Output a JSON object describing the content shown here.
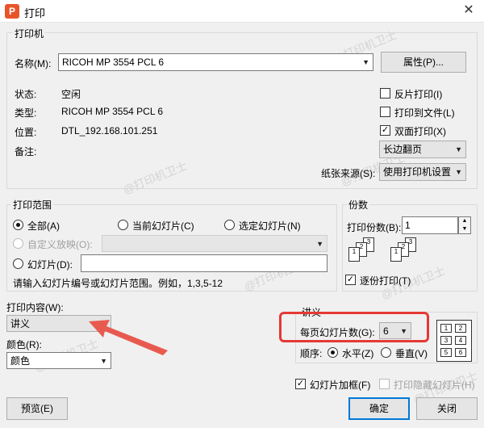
{
  "window": {
    "title": "打印",
    "app_icon_letter": "P"
  },
  "printer": {
    "section_label": "打印机",
    "name_label": "名称(M):",
    "name_value": "RICOH MP 3554 PCL 6",
    "properties_button": "属性(P)...",
    "status_label": "状态:",
    "status_value": "空闲",
    "type_label": "类型:",
    "type_value": "RICOH MP 3554 PCL 6",
    "location_label": "位置:",
    "location_value": "DTL_192.168.101.251",
    "comment_label": "备注:",
    "reverse_print_label": "反片打印(I)",
    "reverse_print_checked": false,
    "print_to_file_label": "打印到文件(L)",
    "print_to_file_checked": false,
    "duplex_label": "双面打印(X)",
    "duplex_checked": true,
    "flip_value": "长边翻页",
    "paper_source_label": "纸张来源(S):",
    "paper_source_value": "使用打印机设置"
  },
  "range": {
    "section_label": "打印范围",
    "all_label": "全部(A)",
    "current_label": "当前幻灯片(C)",
    "selected_label": "选定幻灯片(N)",
    "custom_show_label": "自定义放映(O):",
    "slides_label": "幻灯片(D):",
    "slides_value": "",
    "hint": "请输入幻灯片编号或幻灯片范围。例如，1,3,5-12",
    "selected_option": "all"
  },
  "copies": {
    "section_label": "份数",
    "count_label": "打印份数(B):",
    "count_value": "1",
    "collate_label": "逐份打印(T)",
    "collate_checked": true
  },
  "content": {
    "label": "打印内容(W):",
    "value": "讲义",
    "color_label": "颜色(R):",
    "color_value": "颜色"
  },
  "handout": {
    "section_label": "讲义",
    "per_page_label": "每页幻灯片数(G):",
    "per_page_value": "6",
    "order_label": "顺序:",
    "horizontal_label": "水平(Z)",
    "vertical_label": "垂直(V)",
    "order_selected": "horizontal"
  },
  "options": {
    "frame_label": "幻灯片加框(F)",
    "frame_checked": true,
    "print_hidden_label": "打印隐藏幻灯片(H)",
    "print_hidden_checked": false
  },
  "buttons": {
    "preview": "预览(E)",
    "ok": "确定",
    "close": "关闭"
  },
  "watermark": "@打印机卫士",
  "annotation": {
    "highlight_color": "#e53935",
    "arrow_color": "#e85a4f"
  }
}
